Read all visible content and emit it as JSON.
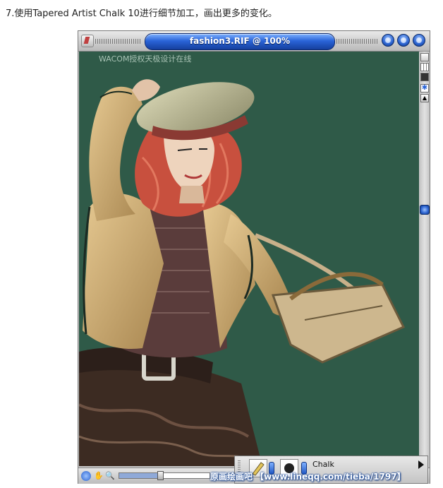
{
  "caption": "7.使用Tapered Artist Chalk 10进行细节加工，画出更多的变化。",
  "window": {
    "title": "fashion3.RIF @ 100%",
    "controls": [
      "minimize-icon",
      "maximize-icon",
      "close-icon"
    ]
  },
  "canvas": {
    "background": "#2f5a48",
    "watermark": "WACOM授权天极设计在线"
  },
  "scroll_tools": [
    "layer-icon",
    "grid-icon",
    "color-icon",
    "star-icon",
    "up-arrow-icon"
  ],
  "status_bar": {
    "icons": [
      "globe-icon",
      "grabber-icon",
      "magnifier-icon"
    ],
    "zoom_level": 0.45
  },
  "brush_selector": {
    "category_icon": "chalk-pencil-icon",
    "variant_icon": "dab-preview-icon",
    "brush_category": "Chalk"
  },
  "footer_watermark": "原画绘画吧 【www.lineqq.com/tieba/1797】",
  "colors": {
    "accent": "#2a64d8",
    "canvas": "#2f5a48",
    "hair": "#c8503e",
    "jacket": "#d9b57a"
  }
}
